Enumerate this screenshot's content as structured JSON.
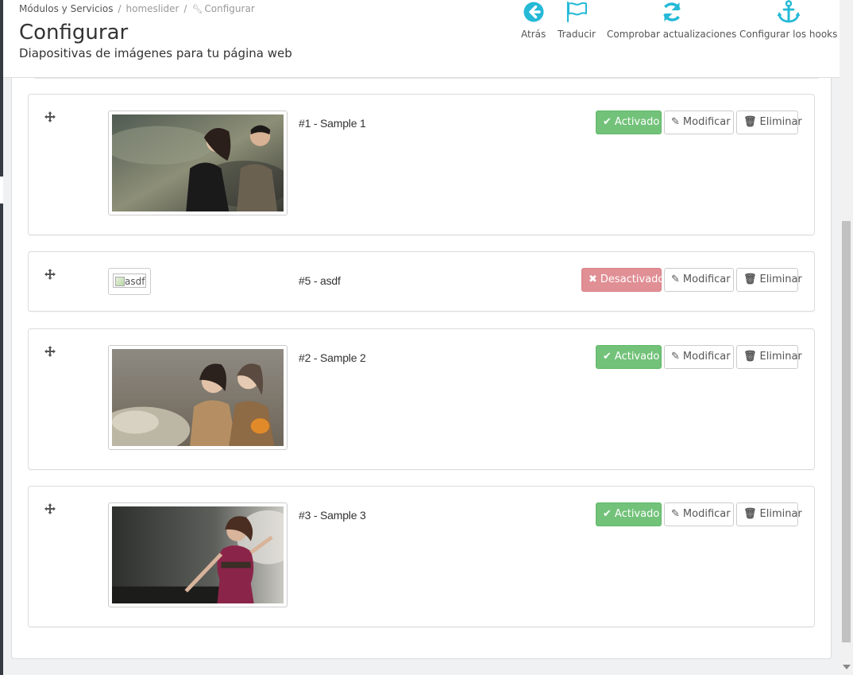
{
  "breadcrumb": {
    "items": [
      "Módulos y Servicios",
      "homeslider",
      "Configurar"
    ],
    "separator": "/"
  },
  "header": {
    "title": "Configurar",
    "subtitle": "Diapositivas de imágenes para tu página web"
  },
  "toolbar": {
    "back": {
      "label": "Atrás",
      "icon": "arrow-circle-left-icon"
    },
    "translate": {
      "label": "Traducir",
      "icon": "flag-icon"
    },
    "check_updates": {
      "label": "Comprobar actualizaciones",
      "icon": "refresh-icon"
    },
    "hooks": {
      "label": "Configurar los hooks",
      "icon": "anchor-icon"
    }
  },
  "colors": {
    "accent": "#25b9d7",
    "enabled": "#72c279",
    "disabled": "#e08f95"
  },
  "slides": [
    {
      "title": "#1 - Sample 1",
      "status": "Activado",
      "enabled": true,
      "image_alt": ""
    },
    {
      "title": "#5 - asdf",
      "status": "Desactivado",
      "enabled": false,
      "image_alt": "asdf"
    },
    {
      "title": "#2 - Sample 2",
      "status": "Activado",
      "enabled": true,
      "image_alt": ""
    },
    {
      "title": "#3 - Sample 3",
      "status": "Activado",
      "enabled": true,
      "image_alt": ""
    }
  ],
  "actions": {
    "edit_label": "Modificar",
    "delete_label": "Eliminar"
  }
}
